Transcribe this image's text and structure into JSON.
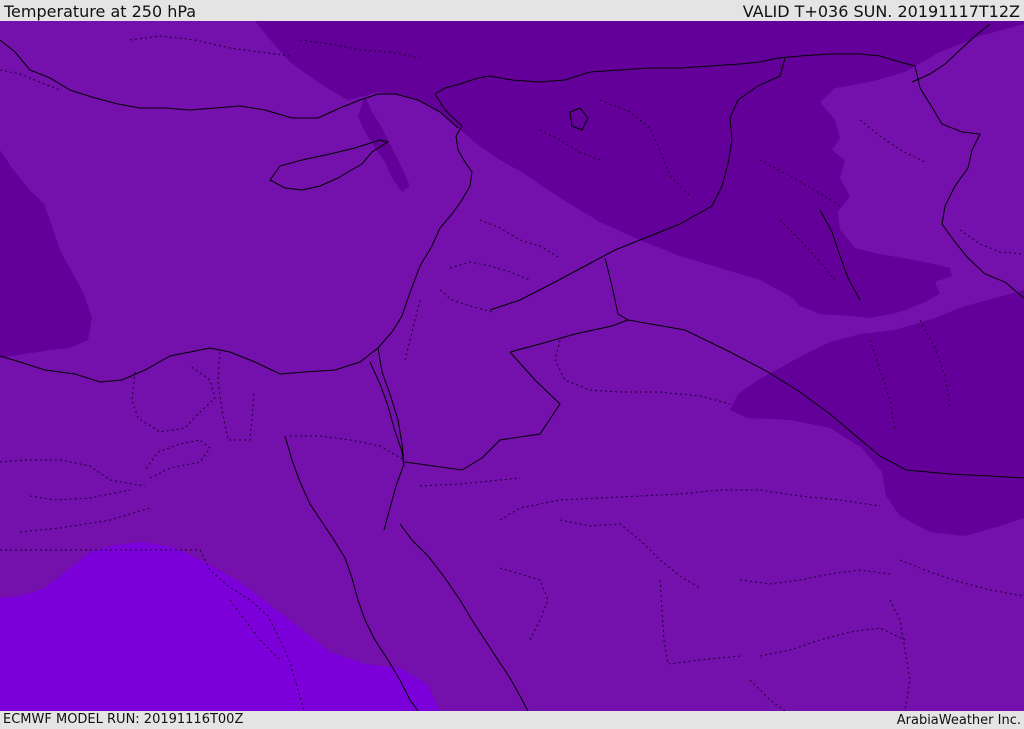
{
  "header": {
    "title": "Temperature at 250 hPa",
    "valid_time": "VALID T+036 SUN. 20191117T12Z"
  },
  "footer": {
    "model_run": "ECMWF MODEL RUN: 20191116T00Z",
    "credit": "ArabiaWeather Inc."
  },
  "colors": {
    "band_mid": "#7410ab",
    "band_cold": "#64009a",
    "band_warm": "#7c00da",
    "coastline": "#000000",
    "border_dotted": "#1a0030"
  }
}
